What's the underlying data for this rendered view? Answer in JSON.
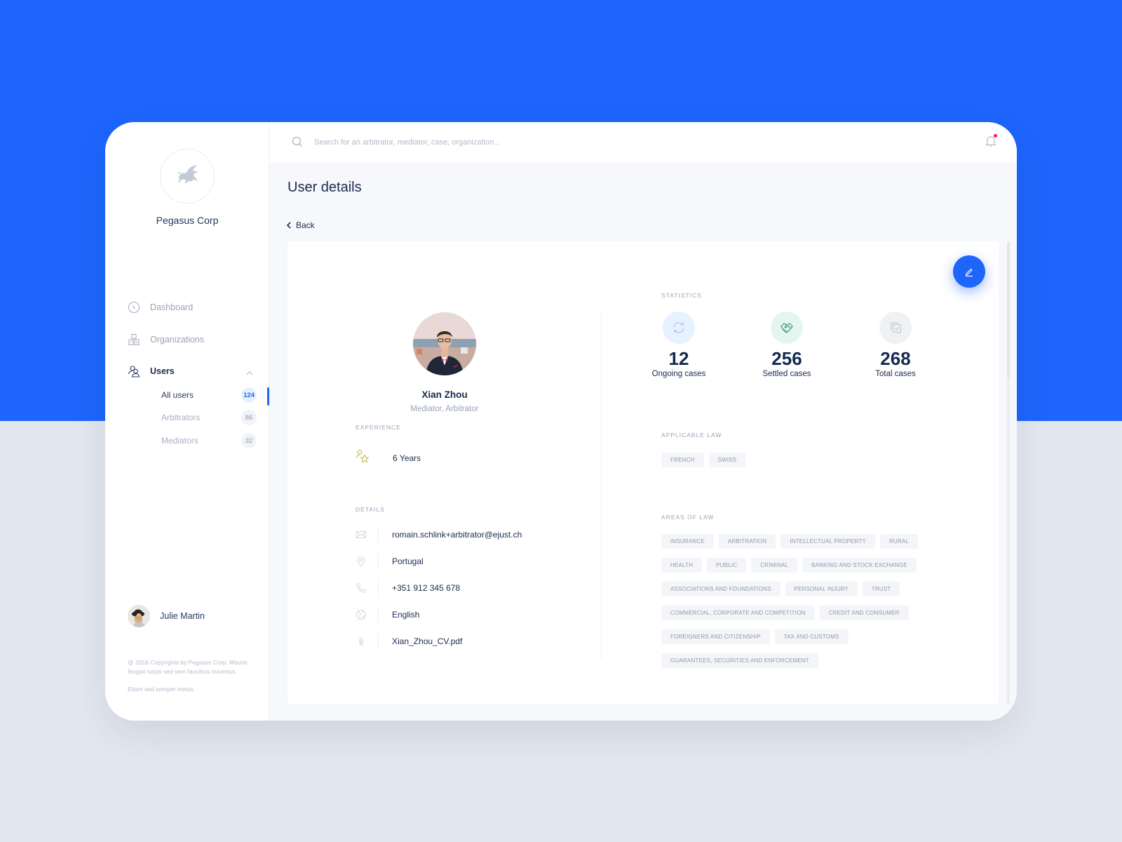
{
  "colors": {
    "brand_blue": "#1d65fb",
    "notification_dot": "#ff1a4b",
    "text_dark": "#1b2a4e",
    "text_muted": "#9aa3b8"
  },
  "sidebar": {
    "logo_icon": "pegasus-logo-icon",
    "org_name": "Pegasus Corp",
    "nav": [
      {
        "label": "Dashboard",
        "icon": "dashboard-gauge-icon"
      },
      {
        "label": "Organizations",
        "icon": "organizations-building-icon"
      },
      {
        "label": "Users",
        "icon": "users-icon",
        "expanded": true
      }
    ],
    "sub_items": [
      {
        "label": "All users",
        "count": "124",
        "active": true
      },
      {
        "label": "Arbitrators",
        "count": "86"
      },
      {
        "label": "Mediators",
        "count": "32"
      }
    ],
    "current_user": {
      "name": "Julie Martin"
    },
    "copyright": "@ 2018 Copyrights by Pegasus Corp. Mauris feugiat turpis sed sem faucibus maximus.",
    "copyright_extra": "Etiam sed semper metus."
  },
  "topbar": {
    "search_placeholder": "Search for an arbitrator, mediator, case, organization...",
    "search_value": "",
    "notifications_unread": true
  },
  "page": {
    "title": "User details",
    "back_label": "Back"
  },
  "profile": {
    "name": "Xian Zhou",
    "roles": "Mediator, Arbitrator",
    "experience_label": "EXPERIENCE",
    "experience_value": "6 Years",
    "details_label": "DETAILS",
    "details": [
      {
        "icon": "mail-icon",
        "value": "romain.schlink+arbitrator@ejust.ch"
      },
      {
        "icon": "location-pin-icon",
        "value": "Portugal"
      },
      {
        "icon": "phone-icon",
        "value": "+351 912 345 678"
      },
      {
        "icon": "globe-icon",
        "value": "English"
      },
      {
        "icon": "paperclip-icon",
        "value": "Xian_Zhou_CV.pdf"
      }
    ]
  },
  "statistics": {
    "label": "STATISTICS",
    "items": [
      {
        "value": "12",
        "caption": "Ongoing cases",
        "icon": "refresh-icon"
      },
      {
        "value": "256",
        "caption": "Settled cases",
        "icon": "handshake-icon"
      },
      {
        "value": "268",
        "caption": "Total cases",
        "icon": "copy-check-icon"
      }
    ]
  },
  "applicable_law": {
    "label": "APPLICABLE LAW",
    "items": [
      "FRENCH",
      "SWISS"
    ]
  },
  "areas_of_law": {
    "label": "AREAS OF LAW",
    "items": [
      "INSURANCE",
      "ARBITRATION",
      "INTELLECTUAL PROPERTY",
      "RURAL",
      "HEALTH",
      "PUBLIC",
      "CRIMINAL",
      "BANKING AND STOCK EXCHANGE",
      "ASSOCIATIONS AND FOUNDATIONS",
      "PERSONAL INJURY",
      "TRUST",
      "COMMERCIAL, CORPORATE AND COMPETITION",
      "CREDIT AND CONSUMER",
      "FOREIGNERS AND CITIZENSHIP",
      "TAX AND CUSTOMS",
      "GUARANTEES, SECURITIES AND ENFORCEMENT"
    ]
  }
}
